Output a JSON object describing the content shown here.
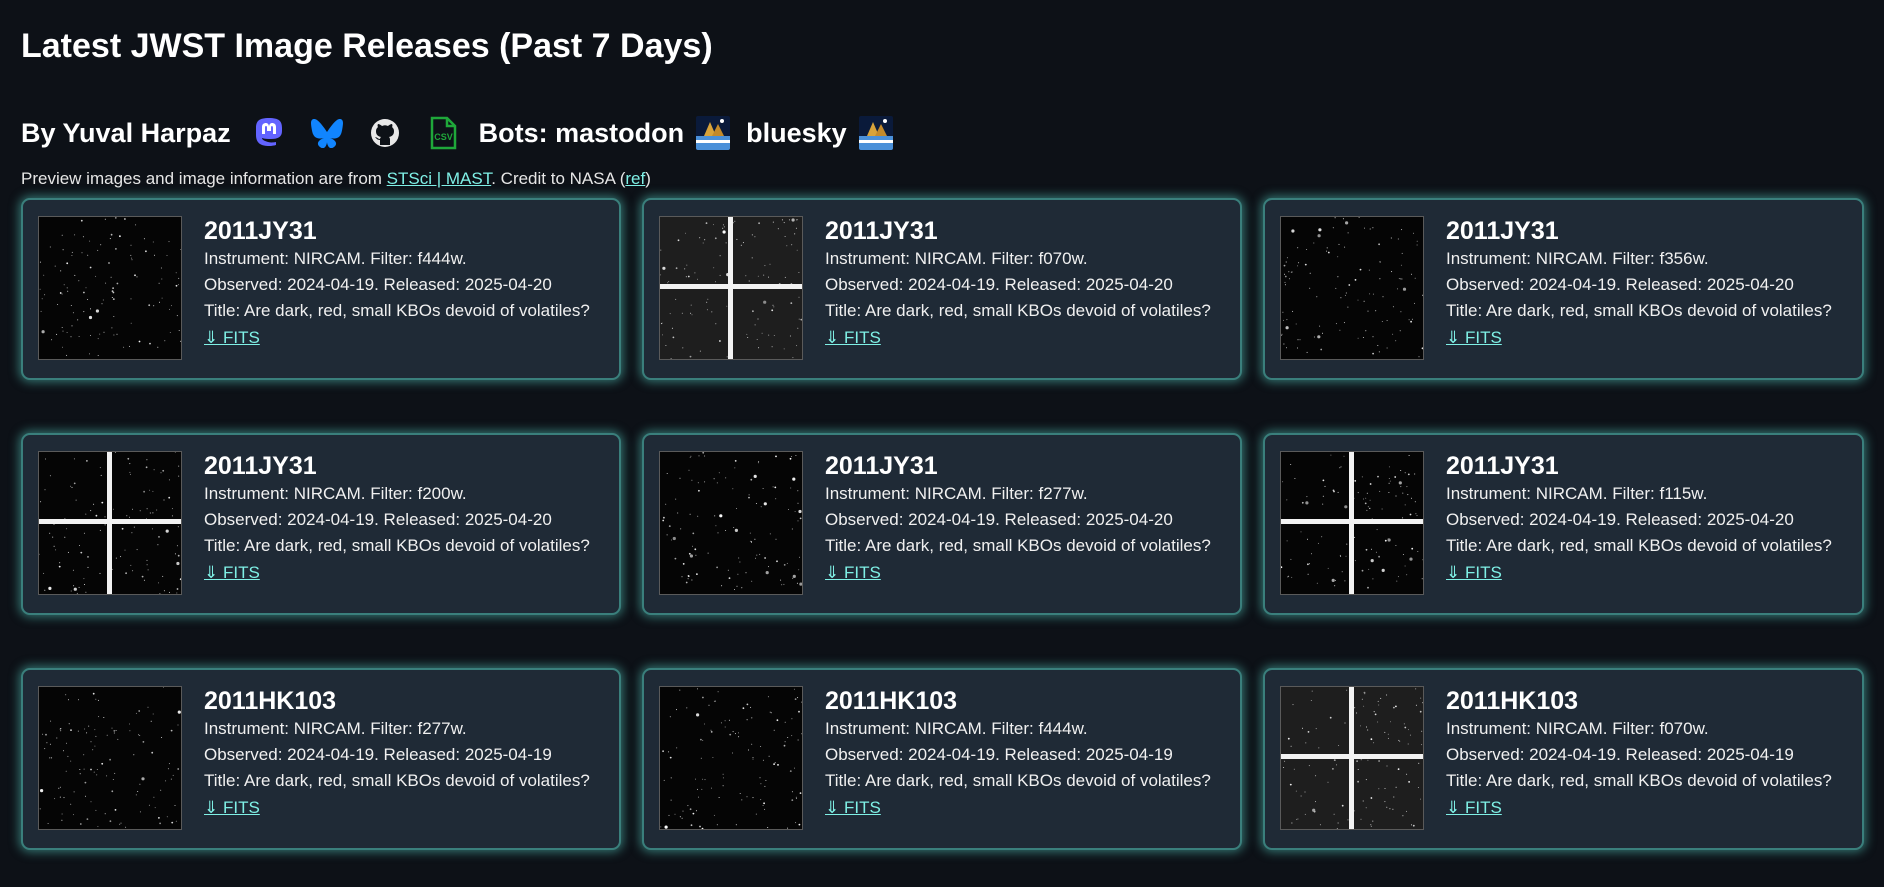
{
  "page": {
    "title": "Latest JWST Image Releases (Past 7 Days)",
    "byline": "By Yuval Harpaz",
    "icons": [
      "mastodon-icon",
      "bluesky-icon",
      "github-icon",
      "csv-file-icon"
    ],
    "bots_label": "Bots: mastodon",
    "bluesky_label": "bluesky",
    "credit_prefix": "Preview images and image information are from ",
    "credit_link": "STSci | MAST",
    "credit_middle": ". Credit to NASA (",
    "credit_ref": "ref",
    "credit_suffix": ")"
  },
  "colors": {
    "accent": "#7ff0e6",
    "card_bg": "#1f2a36",
    "card_border": "#3a7f7c",
    "page_bg": "#0d1117"
  },
  "cards": [
    {
      "name": "2011JY31",
      "instrument": "Instrument: NIRCAM. Filter: f444w.",
      "dates": "Observed: 2024-04-19. Released: 2025-04-20",
      "title": "Title: Are dark, red, small KBOs devoid of volatiles?",
      "fits": "⇓ FITS"
    },
    {
      "name": "2011JY31",
      "instrument": "Instrument: NIRCAM. Filter: f070w.",
      "dates": "Observed: 2024-04-19. Released: 2025-04-20",
      "title": "Title: Are dark, red, small KBOs devoid of volatiles?",
      "fits": "⇓ FITS"
    },
    {
      "name": "2011JY31",
      "instrument": "Instrument: NIRCAM. Filter: f356w.",
      "dates": "Observed: 2024-04-19. Released: 2025-04-20",
      "title": "Title: Are dark, red, small KBOs devoid of volatiles?",
      "fits": "⇓ FITS"
    },
    {
      "name": "2011JY31",
      "instrument": "Instrument: NIRCAM. Filter: f200w.",
      "dates": "Observed: 2024-04-19. Released: 2025-04-20",
      "title": "Title: Are dark, red, small KBOs devoid of volatiles?",
      "fits": "⇓ FITS"
    },
    {
      "name": "2011JY31",
      "instrument": "Instrument: NIRCAM. Filter: f277w.",
      "dates": "Observed: 2024-04-19. Released: 2025-04-20",
      "title": "Title: Are dark, red, small KBOs devoid of volatiles?",
      "fits": "⇓ FITS"
    },
    {
      "name": "2011JY31",
      "instrument": "Instrument: NIRCAM. Filter: f115w.",
      "dates": "Observed: 2024-04-19. Released: 2025-04-20",
      "title": "Title: Are dark, red, small KBOs devoid of volatiles?",
      "fits": "⇓ FITS"
    },
    {
      "name": "2011HK103",
      "instrument": "Instrument: NIRCAM. Filter: f277w.",
      "dates": "Observed: 2024-04-19. Released: 2025-04-19",
      "title": "Title: Are dark, red, small KBOs devoid of volatiles?",
      "fits": "⇓ FITS"
    },
    {
      "name": "2011HK103",
      "instrument": "Instrument: NIRCAM. Filter: f444w.",
      "dates": "Observed: 2024-04-19. Released: 2025-04-19",
      "title": "Title: Are dark, red, small KBOs devoid of volatiles?",
      "fits": "⇓ FITS"
    },
    {
      "name": "2011HK103",
      "instrument": "Instrument: NIRCAM. Filter: f070w.",
      "dates": "Observed: 2024-04-19. Released: 2025-04-19",
      "title": "Title: Are dark, red, small KBOs devoid of volatiles?",
      "fits": "⇓ FITS"
    }
  ]
}
